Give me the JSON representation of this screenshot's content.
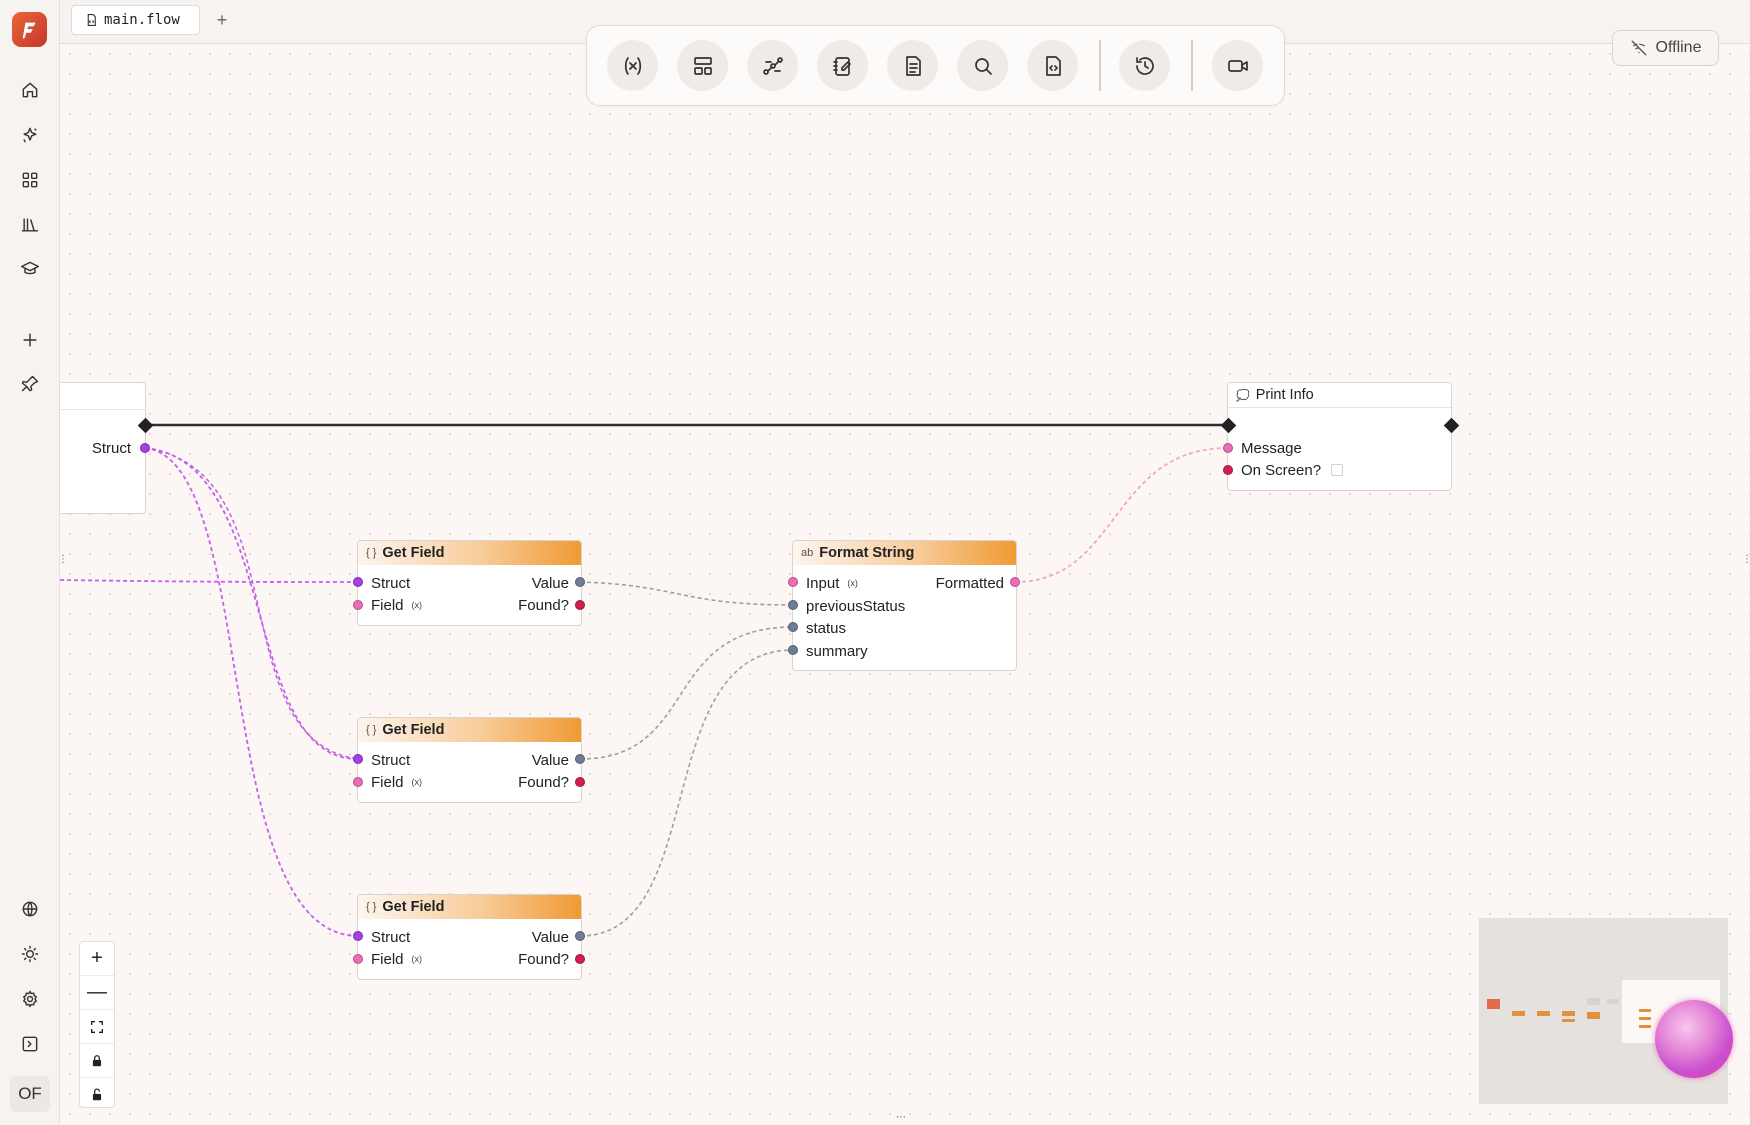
{
  "tab": {
    "filename": "main.flow",
    "add_label": "+"
  },
  "sidebar": {
    "logo": "flow-logo",
    "top_items": [
      "home-icon",
      "sparkles-icon",
      "grid-icon",
      "library-icon",
      "graduation-cap-icon"
    ],
    "mid_items": [
      "plus-icon",
      "pin-icon"
    ],
    "bottom_items": [
      "globe-icon",
      "sun-icon",
      "gear-icon",
      "terminal-icon"
    ],
    "avatar": "OF"
  },
  "toolbar": {
    "buttons": [
      "variable-icon",
      "layout-icon",
      "graph-icon",
      "notebook-icon",
      "document-icon",
      "search-icon",
      "code-file-icon",
      "history-icon",
      "video-icon"
    ]
  },
  "status": {
    "offline_label": "Offline"
  },
  "nodes": {
    "struct_source": {
      "out_label": "Struct"
    },
    "print_info": {
      "title": "Print Info",
      "in_message": "Message",
      "in_on_screen": "On Screen?"
    },
    "get_field_1": {
      "title": "Get Field",
      "in_struct": "Struct",
      "in_field": "Field",
      "out_value": "Value",
      "out_found": "Found?"
    },
    "get_field_2": {
      "title": "Get Field",
      "in_struct": "Struct",
      "in_field": "Field",
      "out_value": "Value",
      "out_found": "Found?"
    },
    "get_field_3": {
      "title": "Get Field",
      "in_struct": "Struct",
      "in_field": "Field",
      "out_value": "Value",
      "out_found": "Found?"
    },
    "format_string": {
      "title": "Format String",
      "in_input": "Input",
      "out_formatted": "Formatted",
      "in_previous_status": "previousStatus",
      "in_status": "status",
      "in_summary": "summary"
    }
  },
  "colors": {
    "accent_orange": "#f09a33",
    "port_purple": "#a23fe6",
    "port_pink": "#ec6cb5",
    "port_gray": "#6f7d94",
    "port_red": "#d11f4e"
  },
  "zoom_controls": [
    "zoom-in-icon",
    "zoom-out-icon",
    "fit-view-icon",
    "lock-icon",
    "unlock-icon"
  ]
}
